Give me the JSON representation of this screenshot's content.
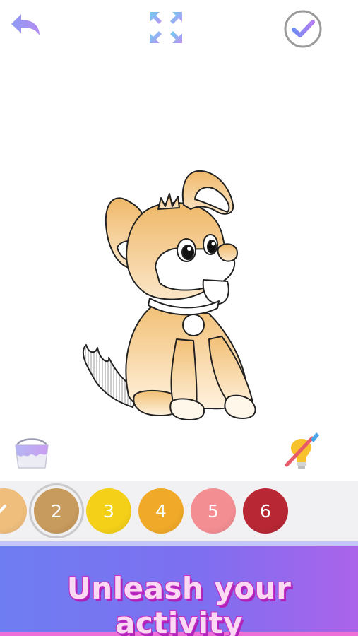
{
  "toolbar": {
    "back_icon": "undo-arrow-icon",
    "fullscreen_icon": "expand-arrows-icon",
    "done_icon": "checkmark-circle-icon"
  },
  "tools": {
    "bucket_icon": "paint-bucket-icon",
    "brush_icon": "paint-brush-icon"
  },
  "palette": {
    "swatches": [
      {
        "label": "",
        "color": "#efbe7d",
        "state": "completed"
      },
      {
        "label": "2",
        "color": "#c79a5d",
        "state": "selected"
      },
      {
        "label": "3",
        "color": "#f4d018"
      },
      {
        "label": "4",
        "color": "#f0a928"
      },
      {
        "label": "5",
        "color": "#f38e93"
      },
      {
        "label": "6",
        "color": "#b72734"
      }
    ]
  },
  "banner": {
    "text": "Unleash your activity"
  },
  "colors": {
    "accent": "#7c7ef2",
    "banner_text": "#fbd9f2"
  }
}
